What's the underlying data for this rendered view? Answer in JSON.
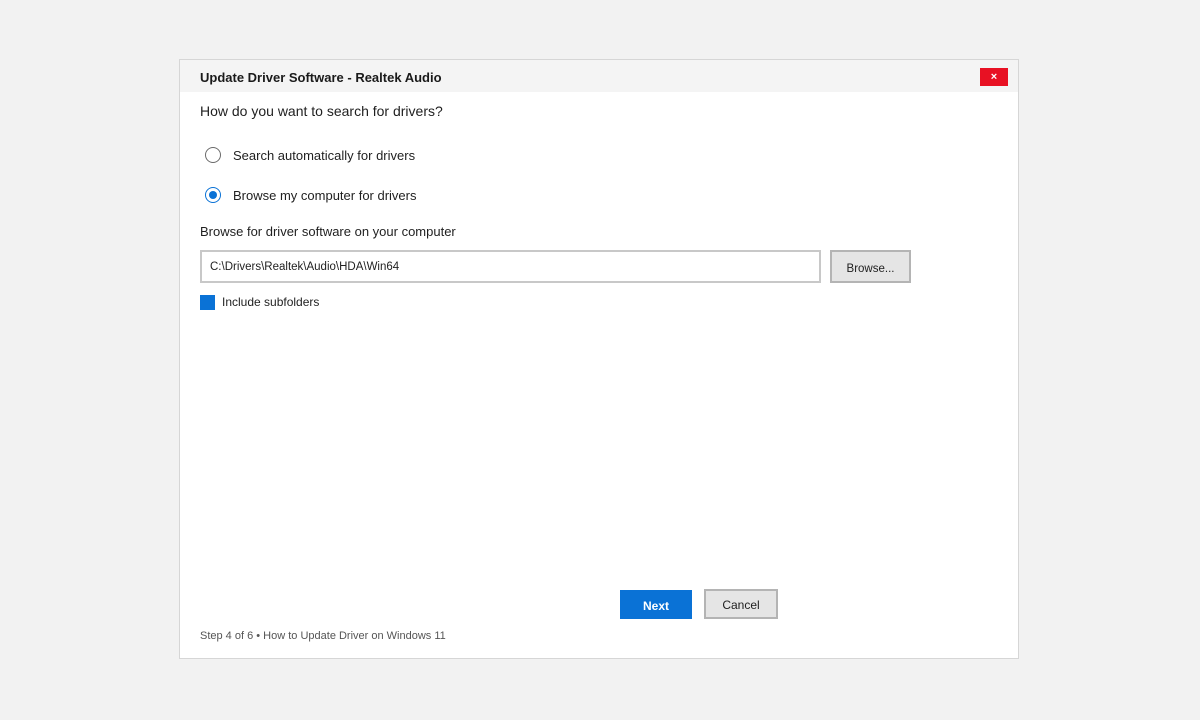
{
  "window": {
    "title": "Update Driver Software - Realtek Audio",
    "close_label": "×"
  },
  "main": {
    "question": "How do you want to search for drivers?",
    "options": [
      {
        "label": "Search automatically for drivers",
        "selected": false
      },
      {
        "label": "Browse my computer for drivers",
        "selected": true
      }
    ],
    "browse_heading": "Browse for driver software on your computer",
    "path_value": "C:\\Drivers\\Realtek\\Audio\\HDA\\Win64",
    "browse_label": "Browse...",
    "include_subfolders_label": "Include subfolders",
    "include_subfolders_checked": true
  },
  "actions": {
    "next_label": "Next",
    "cancel_label": "Cancel"
  },
  "footer": {
    "text": "Step 4 of 6 • How to Update Driver on Windows 11"
  },
  "colors": {
    "accent": "#0a72d6",
    "close": "#e81123",
    "background": "#f2f2f2"
  }
}
